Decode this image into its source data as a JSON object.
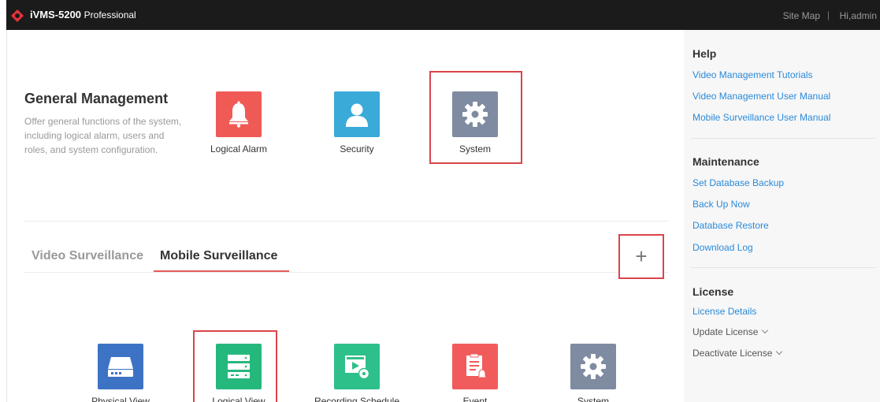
{
  "header": {
    "brand": "iVMS-5200",
    "brand_sub": "Professional",
    "site_map": "Site Map",
    "separator": "|",
    "user": "Hi,admin"
  },
  "general_management": {
    "title": "General Management",
    "description": "Offer general functions of the system, including logical alarm, users and roles, and system configuration.",
    "apps": [
      {
        "label": "Logical Alarm",
        "icon": "bell-icon",
        "color": "#f05a55"
      },
      {
        "label": "Security",
        "icon": "user-icon",
        "color": "#3aaad8"
      },
      {
        "label": "System",
        "icon": "gear-icon",
        "color": "#7f8ba0"
      }
    ]
  },
  "tabs": {
    "video": "Video Surveillance",
    "mobile": "Mobile Surveillance",
    "add": "+"
  },
  "mobile_apps": [
    {
      "label": "Physical View",
      "icon": "storage-device-icon",
      "color": "#3d73c4"
    },
    {
      "label": "Logical View",
      "icon": "server-rack-icon",
      "color": "#25b87d"
    },
    {
      "label": "Recording Schedule",
      "icon": "video-schedule-icon",
      "color": "#2ec08a"
    },
    {
      "label": "Event",
      "icon": "event-clipboard-icon",
      "color": "#f25b5b"
    },
    {
      "label": "System",
      "icon": "gear-icon",
      "color": "#7f8ba0"
    }
  ],
  "sidebar": {
    "help": {
      "title": "Help",
      "links": [
        "Video Management Tutorials",
        "Video Management User Manual",
        "Mobile Surveillance User Manual"
      ]
    },
    "maintenance": {
      "title": "Maintenance",
      "links": [
        "Set Database Backup",
        "Back Up Now",
        "Database Restore",
        "Download Log"
      ]
    },
    "license": {
      "title": "License",
      "link": "License Details",
      "items": [
        "Update License",
        "Deactivate License"
      ]
    }
  },
  "colors": {
    "highlight": "#d9454a",
    "link": "#2a8ad9",
    "topbar": "#1b1b1b"
  }
}
